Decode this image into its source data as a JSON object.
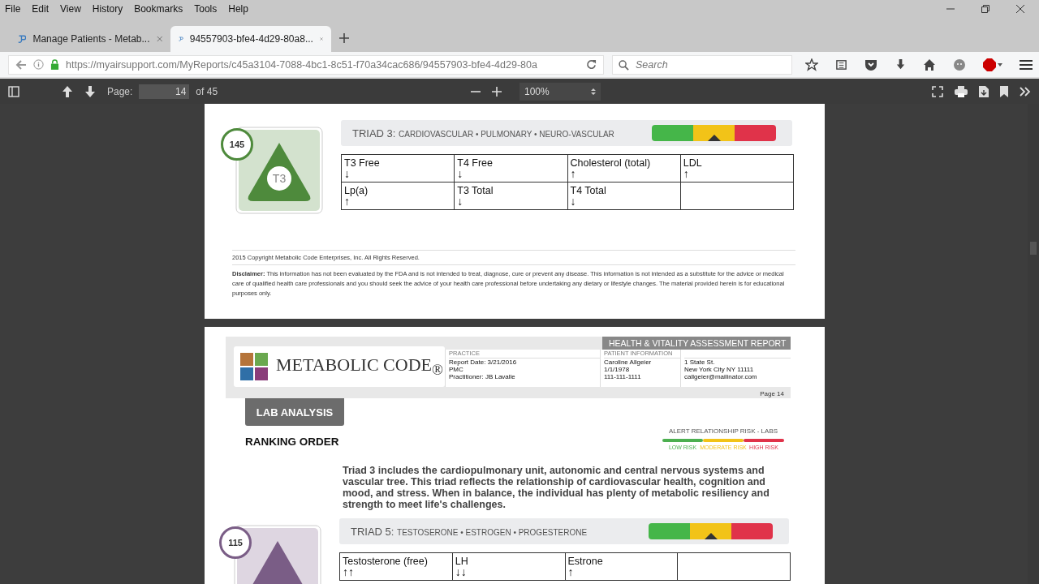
{
  "menu": [
    "File",
    "Edit",
    "View",
    "History",
    "Bookmarks",
    "Tools",
    "Help"
  ],
  "tabs": [
    {
      "title": "Manage Patients - Metab...",
      "selected": false
    },
    {
      "title": "94557903-bfe4-4d29-80a8...",
      "selected": true
    }
  ],
  "address": {
    "url_host": "https://myairsupport.com",
    "url_path": "/MyReports/c45a3104-7088-4bc1-8c51-f70a34cac686/94557903-bfe4-4d29-80a",
    "search_placeholder": "Search"
  },
  "pdf_toolbar": {
    "page_label": "Page:",
    "page_value": "14",
    "page_count": "of 45",
    "zoom": "100%"
  },
  "page_1": {
    "triad": {
      "number": "145",
      "badge": "T3",
      "color": "#4e8a3c",
      "title": "TRIAD 3:",
      "systems": "CARDIOVASCULAR • PULMONARY • NEURO-VASCULAR",
      "risk_segments": [
        {
          "color": "#45b649",
          "selected": false
        },
        {
          "color": "#f2c318",
          "selected": true
        },
        {
          "color": "#e0334a",
          "selected": false
        }
      ],
      "cells": [
        {
          "label": "T3 Free",
          "trend": "↓"
        },
        {
          "label": "T4 Free",
          "trend": "↓"
        },
        {
          "label": "Cholesterol (total)",
          "trend": "↑"
        },
        {
          "label": "LDL",
          "trend": "↑"
        },
        {
          "label": "Lp(a)",
          "trend": "↑"
        },
        {
          "label": "T3 Total",
          "trend": "↓"
        },
        {
          "label": "T4 Total",
          "trend": "↓"
        }
      ]
    },
    "copyright": "2015 Copyright Metabolic Code Enterprises, Inc. All Rights Reserved.",
    "disclaimer": "**Disclaimer:** This information has not been evaluated by the FDA and is not intended to treat, diagnose, cure or prevent any disease. This information is not intended as a substitute for the advice or medical care of qualified health care professionals and you should seek the advice of your health care professional before undertaking any dietary or lifestyle changes. The material provided herein is for educational purposes only."
  },
  "page_2": {
    "brand": "METABOLIC CODE$_{®}$",
    "report_title": "HEALTH & VITALITY ASSESSMENT REPORT",
    "practice_label": "PRACTICE",
    "practice": [
      "Report Date: 3/21/2016",
      "PMC",
      "Practitioner: JB  Lavalle"
    ],
    "patient_label": "PATIENT INFORMATION",
    "patient": [
      "Caroline Allgeier",
      "1/1/1978",
      "111-111-1111"
    ],
    "patient_address": [
      "1 State St.",
      "New York City NY 11111",
      "callgeier@mailinator.com"
    ],
    "page_number": "Page 14",
    "section_tab": "LAB ANALYSIS",
    "heading": "RANKING ORDER",
    "legend": {
      "title": "ALERT RELATIONSHIP RISK - LABS",
      "levels": [
        {
          "label": "LOW RISK",
          "color": "#4caf50"
        },
        {
          "label": "MODERATE RISK",
          "color": "#f2c318"
        },
        {
          "label": "HIGH RISK",
          "color": "#e0334a"
        }
      ]
    },
    "description": "Triad 3 includes the cardiopulmonary unit, autonomic and central nervous systems and vascular tree. This triad reflects the relationship of cardiovascular health, cognition and mood, and stress.  When in balance, the individual has plenty of metabolic resiliency and strength to meet life's challenges.",
    "triad": {
      "number": "115",
      "color": "#7a5d86",
      "title": "TRIAD 5:",
      "systems": "TESTOSERONE • ESTROGEN  • PROGESTERONE",
      "risk_segments": [
        {
          "color": "#45b649",
          "selected": false
        },
        {
          "color": "#f2c318",
          "selected": true
        },
        {
          "color": "#e0334a",
          "selected": false
        }
      ],
      "cells": [
        {
          "label": "Testosterone (free)",
          "trend": "↑↑"
        },
        {
          "label": "LH",
          "trend": "↓↓"
        },
        {
          "label": "Estrone",
          "trend": "↑"
        }
      ]
    }
  }
}
